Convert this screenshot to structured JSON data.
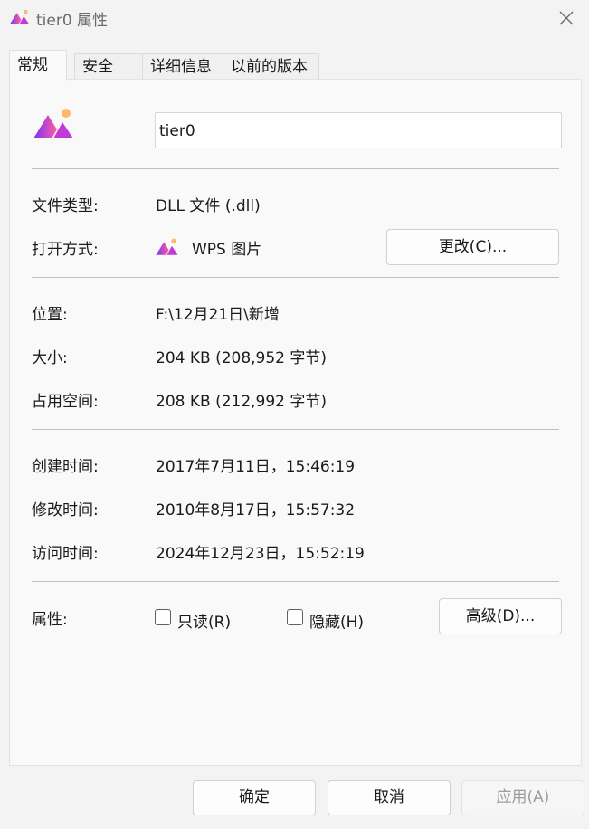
{
  "window": {
    "title": "tier0 属性"
  },
  "tabs": [
    {
      "label": "常规"
    },
    {
      "label": "安全"
    },
    {
      "label": "详细信息"
    },
    {
      "label": "以前的版本"
    }
  ],
  "general": {
    "file_name": "tier0",
    "file_type_label": "文件类型:",
    "file_type_value": "DLL 文件 (.dll)",
    "open_with_label": "打开方式:",
    "open_with_value": "WPS 图片",
    "change_button": "更改(C)...",
    "location_label": "位置:",
    "location_value": "F:\\12月21日\\新增",
    "size_label": "大小:",
    "size_value": "204 KB (208,952 字节)",
    "size_on_disk_label": "占用空间:",
    "size_on_disk_value": "208 KB (212,992 字节)",
    "created_label": "创建时间:",
    "created_value": "2017年7月11日，15:46:19",
    "modified_label": "修改时间:",
    "modified_value": "2010年8月17日，15:57:32",
    "accessed_label": "访问时间:",
    "accessed_value": "2024年12月23日，15:52:19",
    "attributes_label": "属性:",
    "readonly_label": "只读(R)",
    "hidden_label": "隐藏(H)",
    "advanced_button": "高级(D)..."
  },
  "footer": {
    "ok": "确定",
    "cancel": "取消",
    "apply": "应用(A)"
  },
  "colors": {
    "window_bg": "#f3f3f3",
    "panel_bg": "#f9f9f9",
    "disabled_text": "#9d9d9d",
    "icon_purple": "#7b2ff7",
    "icon_pink": "#ff5fa2",
    "icon_orange": "#ffb86b"
  },
  "icons": [
    "wps-picture-icon",
    "close-icon"
  ]
}
